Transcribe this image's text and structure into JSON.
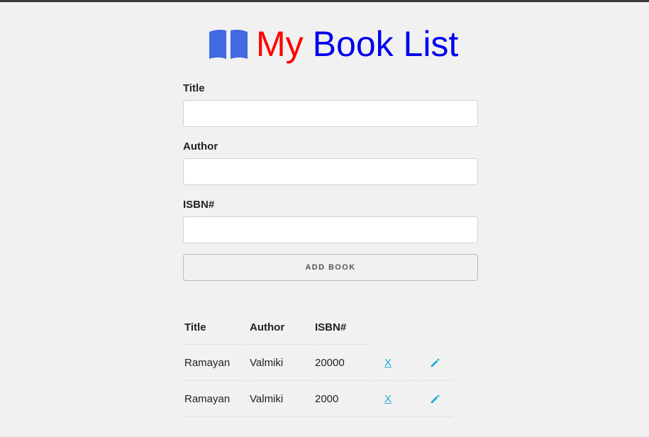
{
  "header": {
    "title_part1": "My",
    "title_part2": "Book List",
    "title_part1_color": "#ff0000",
    "title_part2_color": "#0000ee",
    "icon": "book-open-icon",
    "icon_color": "#4169e1"
  },
  "form": {
    "title_label": "Title",
    "title_value": "",
    "author_label": "Author",
    "author_value": "",
    "isbn_label": "ISBN#",
    "isbn_value": "",
    "submit_label": "ADD BOOK"
  },
  "table": {
    "columns": [
      "Title",
      "Author",
      "ISBN#"
    ],
    "rows": [
      {
        "title": "Ramayan",
        "author": "Valmiki",
        "isbn": "20000",
        "delete_label": "X",
        "edit_icon": "pencil-icon"
      },
      {
        "title": "Ramayan",
        "author": "Valmiki",
        "isbn": "2000",
        "delete_label": "X",
        "edit_icon": "pencil-icon"
      }
    ],
    "link_color": "#1eaedb"
  }
}
